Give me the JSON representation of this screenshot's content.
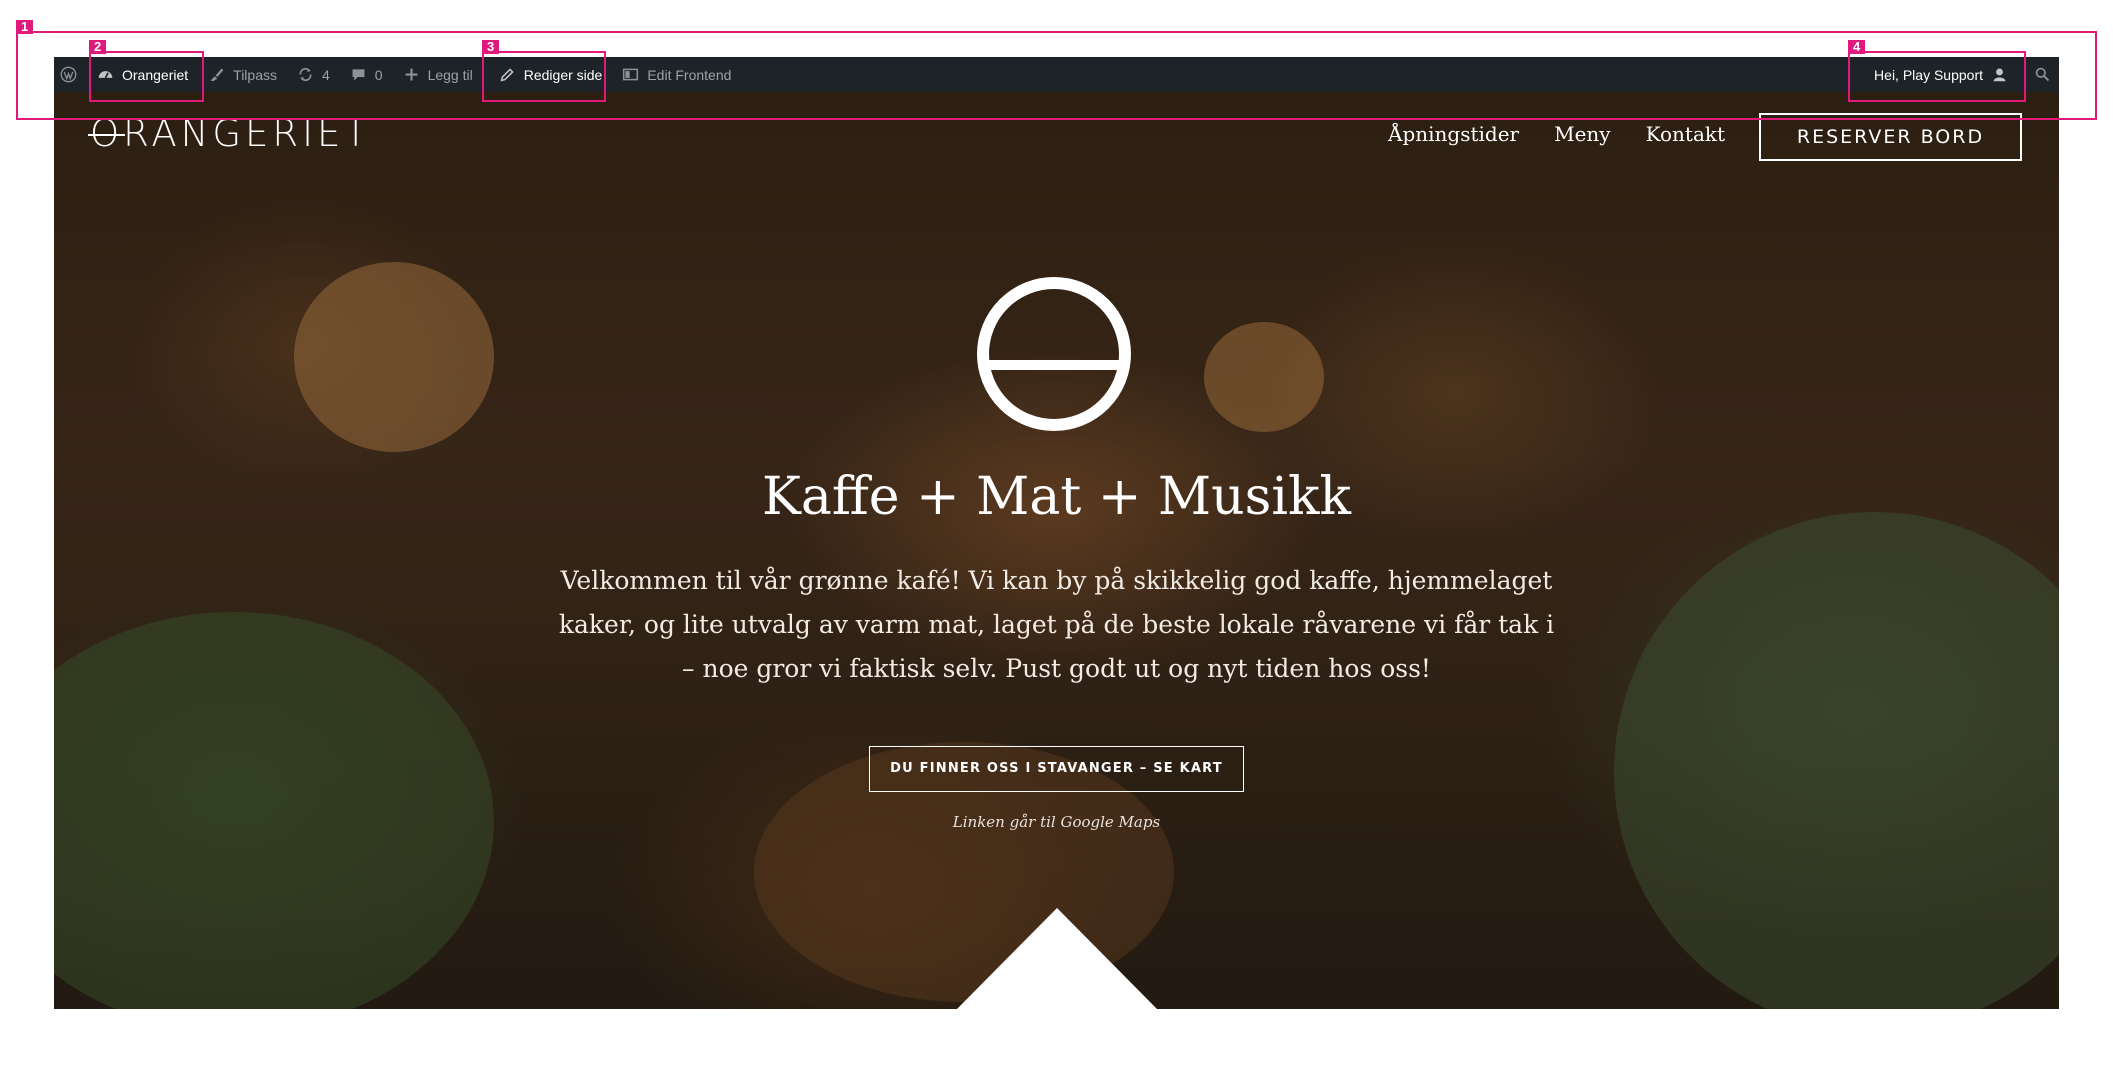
{
  "adminbar": {
    "site_name": "Orangeriet",
    "customize": "Tilpass",
    "updates_count": "4",
    "comments_count": "0",
    "new_label": "Legg til",
    "edit_page": "Rediger side",
    "edit_frontend": "Edit Frontend",
    "greeting": "Hei, Play Support"
  },
  "header": {
    "logo_text": "ORANGERIET",
    "logo_first": "O",
    "logo_rest": "RANGERIET",
    "nav": [
      "Åpningstider",
      "Meny",
      "Kontakt"
    ],
    "reserve_button": "RESERVER BORD"
  },
  "hero": {
    "headline": "Kaffe + Mat + Musikk",
    "intro": "Velkommen til vår grønne kafé! Vi kan by på skikkelig god kaffe, hjemmelaget kaker, og lite utvalg av varm mat, laget på de beste lokale råvarene vi får tak i – noe gror vi faktisk selv. Pust godt ut og nyt tiden hos oss!",
    "map_button": "DU FINNER OSS I STAVANGER – SE KART",
    "map_note": "Linken går til Google Maps"
  },
  "annotations": [
    "1",
    "2",
    "3",
    "4"
  ],
  "colors": {
    "adminbar_bg": "#1d2327",
    "annotation": "#e0197d",
    "text_light": "#ffffff"
  },
  "icons": {
    "wordpress": "wordpress-icon",
    "dashboard": "dashboard-icon",
    "customize": "brush-icon",
    "updates": "updates-icon",
    "comments": "comment-icon",
    "new": "plus-icon",
    "edit": "pencil-icon",
    "frontend": "screen-icon",
    "user": "user-icon",
    "search": "search-icon"
  }
}
